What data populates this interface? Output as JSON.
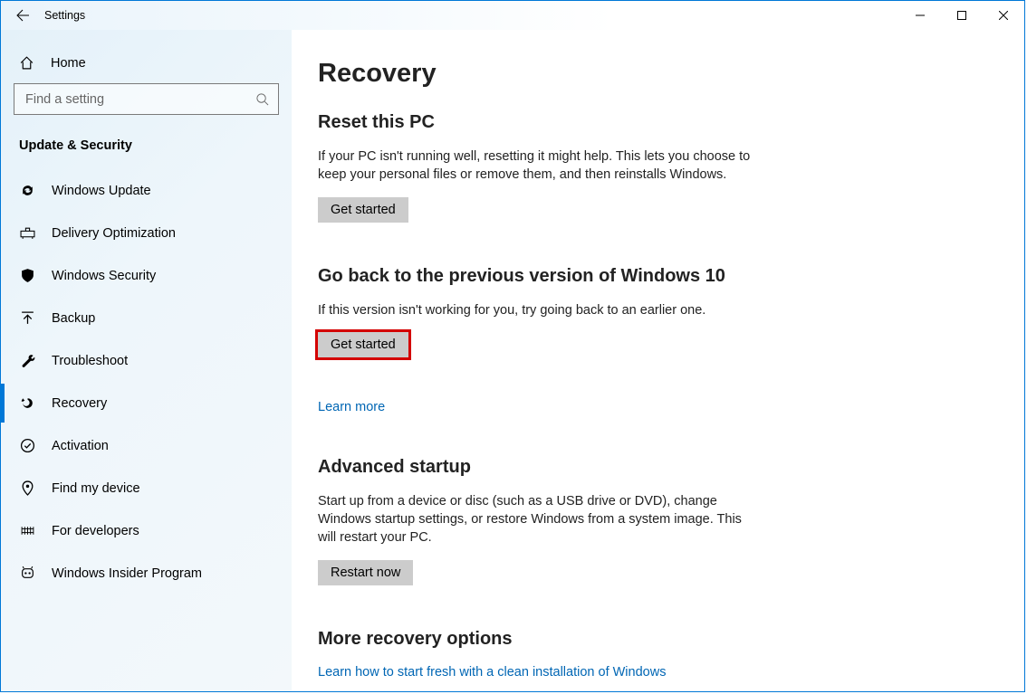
{
  "window": {
    "title": "Settings"
  },
  "sidebar": {
    "home_label": "Home",
    "search_placeholder": "Find a setting",
    "section_title": "Update & Security",
    "items": [
      {
        "label": "Windows Update"
      },
      {
        "label": "Delivery Optimization"
      },
      {
        "label": "Windows Security"
      },
      {
        "label": "Backup"
      },
      {
        "label": "Troubleshoot"
      },
      {
        "label": "Recovery"
      },
      {
        "label": "Activation"
      },
      {
        "label": "Find my device"
      },
      {
        "label": "For developers"
      },
      {
        "label": "Windows Insider Program"
      }
    ]
  },
  "main": {
    "title": "Recovery",
    "reset": {
      "heading": "Reset this PC",
      "desc": "If your PC isn't running well, resetting it might help. This lets you choose to keep your personal files or remove them, and then reinstalls Windows.",
      "button": "Get started"
    },
    "goback": {
      "heading": "Go back to the previous version of Windows 10",
      "desc": "If this version isn't working for you, try going back to an earlier one.",
      "button": "Get started",
      "learn_more": "Learn more"
    },
    "advanced": {
      "heading": "Advanced startup",
      "desc": "Start up from a device or disc (such as a USB drive or DVD), change Windows startup settings, or restore Windows from a system image. This will restart your PC.",
      "button": "Restart now"
    },
    "more": {
      "heading": "More recovery options",
      "link": "Learn how to start fresh with a clean installation of Windows"
    }
  }
}
